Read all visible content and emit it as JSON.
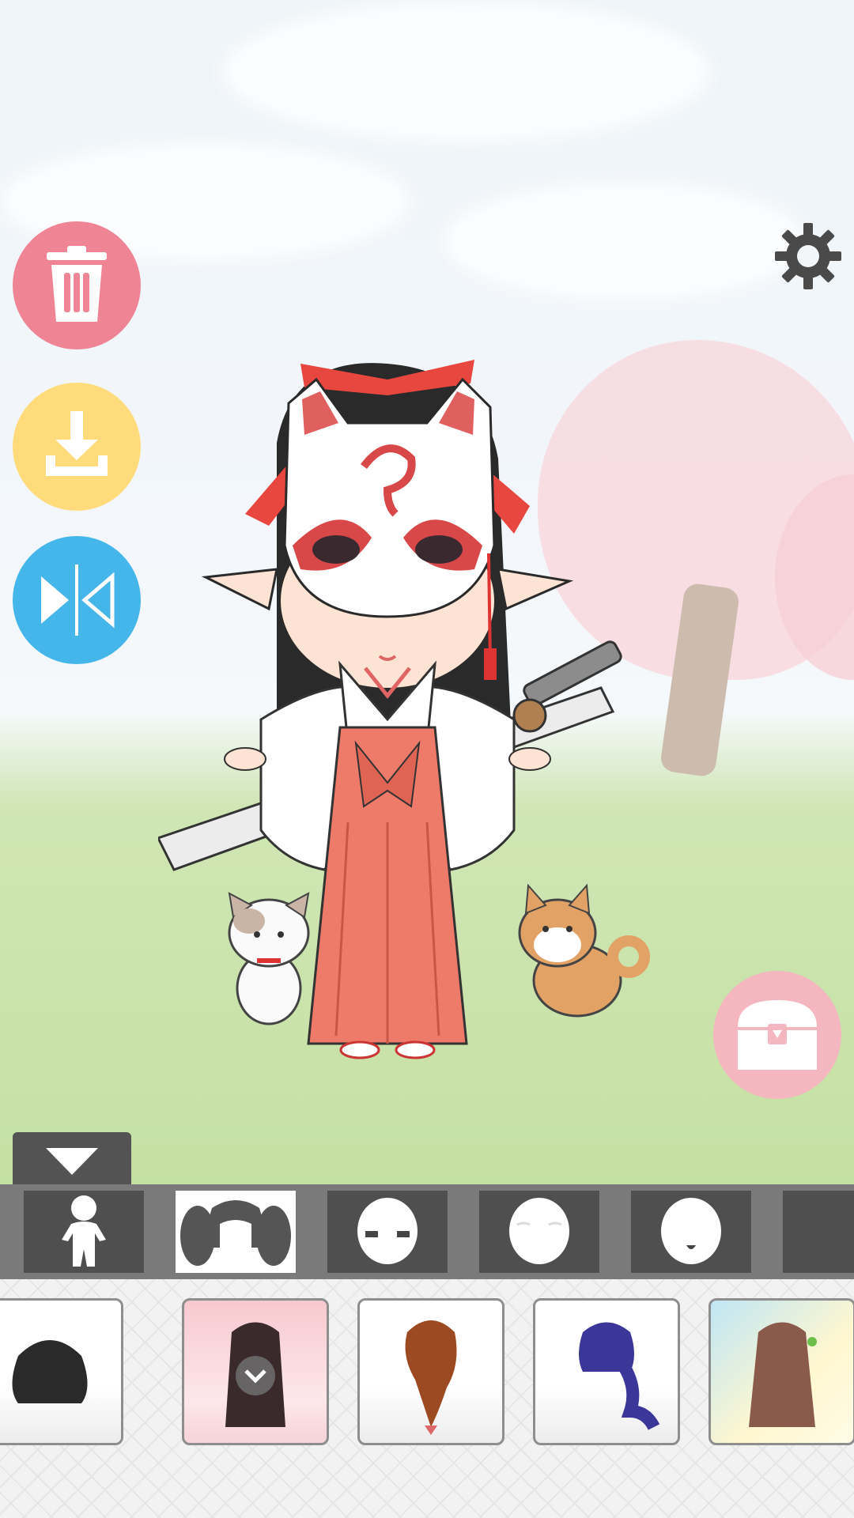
{
  "app": {
    "screen": "avatar-dress-up-editor"
  },
  "actions": {
    "delete_icon": "trash-icon",
    "save_icon": "download-icon",
    "flip_icon": "mirror-flip-icon",
    "settings_icon": "gear-icon",
    "wardrobe_icon": "treasure-chest-icon",
    "collapse_icon": "triangle-down-icon"
  },
  "colors": {
    "delete": "#ee8494",
    "save": "#ffdb7c",
    "flip": "#45b6ea",
    "wardrobe": "#f4b7c0",
    "category_bar": "#7a7a7a",
    "category_tab": "#4f4f4f",
    "category_selected": "#ffffff",
    "selected_item": "#f7c9cf"
  },
  "categories": [
    {
      "icon": "body-icon",
      "selected": false
    },
    {
      "icon": "hair-icon",
      "selected": true
    },
    {
      "icon": "eyes-icon",
      "selected": false
    },
    {
      "icon": "eyebrows-icon",
      "selected": false
    },
    {
      "icon": "mouth-icon",
      "selected": false
    },
    {
      "icon": "next-category-icon",
      "selected": false
    }
  ],
  "items": [
    {
      "icon": "short-black-hair-icon",
      "selected": false
    },
    {
      "icon": "long-dark-hair-icon",
      "selected": true
    },
    {
      "icon": "braided-brown-hair-icon",
      "selected": false
    },
    {
      "icon": "purple-ponytail-hair-icon",
      "selected": false
    },
    {
      "icon": "long-brown-hair-icon",
      "selected": false
    }
  ]
}
